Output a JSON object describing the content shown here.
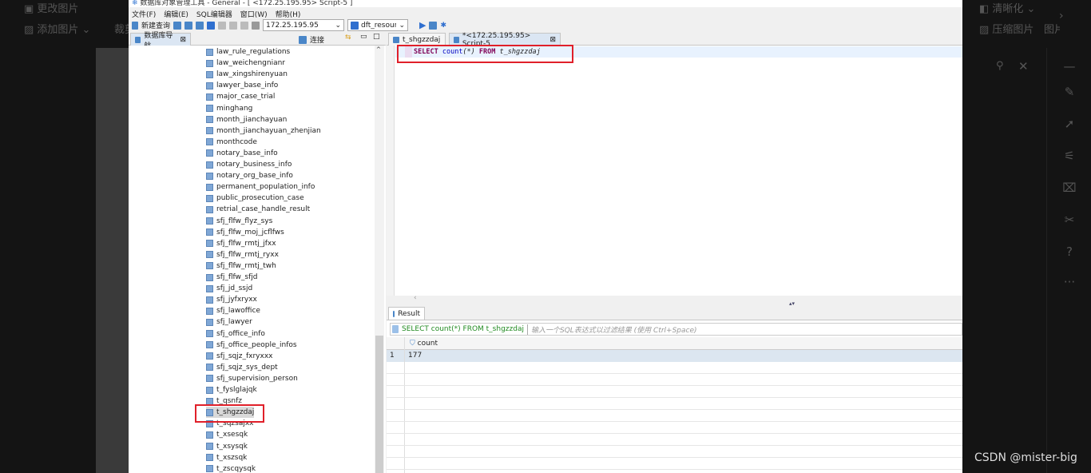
{
  "editor_bg_toolbar": {
    "change_image": "更改图片",
    "add_image": "添加图片 ⌄",
    "crop": "裁剪",
    "sharpen": "清晰化 ⌄",
    "compress": "压缩图片",
    "image": "图片"
  },
  "window": {
    "title": "数据库对象管理工具 - General - [ <172.25.195.95> Script-5 ]"
  },
  "menu": [
    "文件(F)",
    "编辑(E)",
    "SQL编辑器",
    "窗口(W)",
    "帮助(H)"
  ],
  "toolbar": {
    "new_query": "新建查询",
    "connection": "172.25.195.95",
    "database": "dft_resourc"
  },
  "navigator": {
    "tab": "数据库导航",
    "connect": "连接",
    "items": [
      "law_rule_regulations",
      "law_weichengnianr",
      "law_xingshirenyuan",
      "lawyer_base_info",
      "major_case_trial",
      "minghang",
      "month_jianchayuan",
      "month_jianchayuan_zhenjian",
      "monthcode",
      "notary_base_info",
      "notary_business_info",
      "notary_org_base_info",
      "permanent_population_info",
      "public_prosecution_case",
      "retrial_case_handle_result",
      "sfj_flfw_flyz_sys",
      "sfj_flfw_moj_jcflfws",
      "sfj_flfw_rmtj_jfxx",
      "sfj_flfw_rmtj_ryxx",
      "sfj_flfw_rmtj_twh",
      "sfj_flfw_sfjd",
      "sfj_jd_ssjd",
      "sfj_jyfxryxx",
      "sfj_lawoffice",
      "sfj_lawyer",
      "sfj_office_info",
      "sfj_office_people_infos",
      "sfj_sqjz_fxryxxx",
      "sfj_sqjz_sys_dept",
      "sfj_supervision_person",
      "t_fyslglajqk",
      "t_qsnfz",
      "t_shgzzdaj",
      "t_sqzsajxx",
      "t_xsesqk",
      "t_xsysqk",
      "t_xszsqk",
      "t_zscqysqk"
    ],
    "selected": "t_shgzzdaj"
  },
  "editor": {
    "tabs": [
      "t_shgzzdaj",
      "*<172.25.195.95> Script-5"
    ],
    "sql": {
      "kw1": "SELECT",
      "fn": "count",
      "arg": "(*)",
      "kw2": "FROM",
      "table": "t_shgzzdaj"
    }
  },
  "result": {
    "tab": "Result",
    "query": "SELECT count(*) FROM t_shgzzdaj",
    "filter_placeholder": "输入一个SQL表达式以过滤结果 (使用 Ctrl+Space)",
    "column": "count",
    "rows": [
      {
        "num": "1",
        "count": "177"
      }
    ]
  },
  "watermark": "CSDN @mister-big",
  "colors": {
    "highlight": "#e0202a",
    "selected_row": "#dce6f0"
  }
}
